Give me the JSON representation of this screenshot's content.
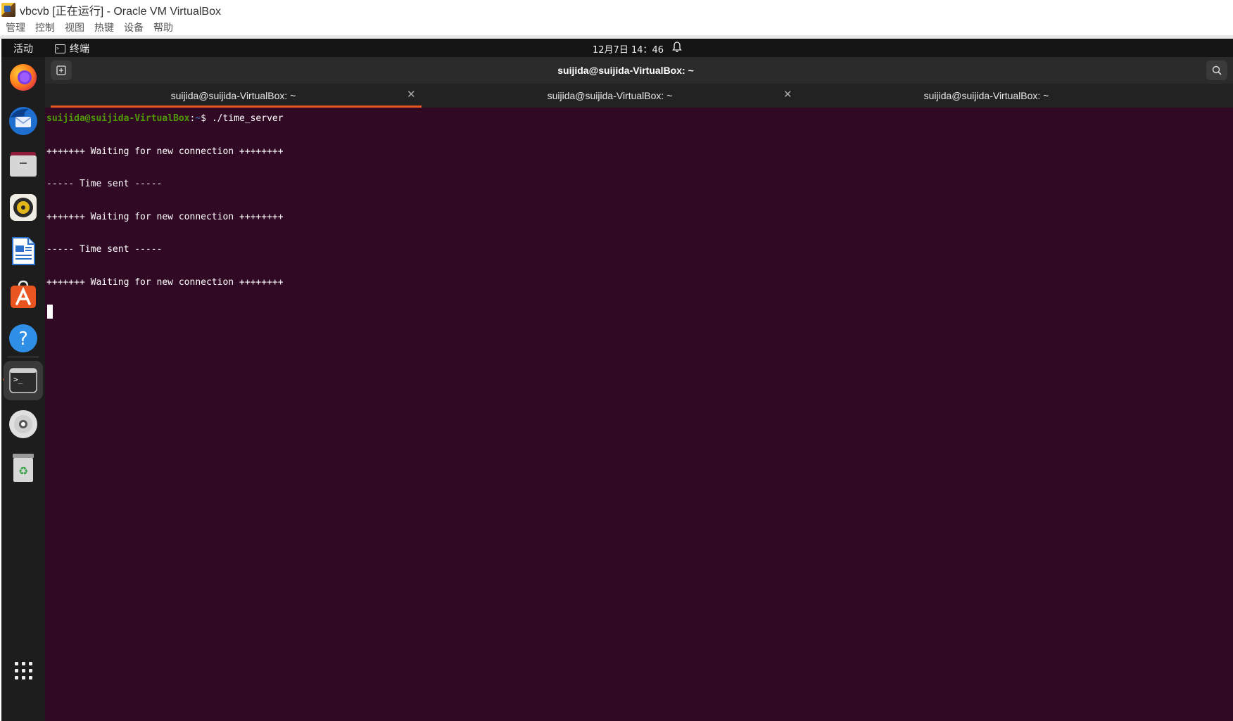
{
  "host": {
    "title": "vbcvb [正在运行] - Oracle VM VirtualBox",
    "menu": [
      "管理",
      "控制",
      "视图",
      "热键",
      "设备",
      "帮助"
    ]
  },
  "guest": {
    "topbar": {
      "activities": "活动",
      "app_name": "终端",
      "clock": "12月7日  14：46"
    },
    "dock": {
      "items": [
        "firefox-icon",
        "thunderbird-icon",
        "files-icon",
        "rhythmbox-icon",
        "libreoffice-writer-icon",
        "app-center-icon",
        "help-icon",
        "terminal-icon",
        "dvd-icon",
        "trash-icon",
        "show-apps-icon"
      ],
      "active": "terminal-icon"
    },
    "terminal": {
      "title": "suijida@suijida-VirtualBox: ~",
      "tabs": [
        {
          "label": "suijida@suijida-VirtualBox: ~",
          "active": true
        },
        {
          "label": "suijida@suijida-VirtualBox: ~",
          "active": false
        },
        {
          "label": "suijida@suijida-VirtualBox: ~",
          "active": false
        }
      ],
      "prompt_user": "suijida@suijida-VirtualBox",
      "prompt_sep": ":",
      "prompt_path": "~",
      "prompt_symbol": "$ ",
      "command": "./time_server",
      "output": [
        "+++++++ Waiting for new connection ++++++++",
        "----- Time sent -----",
        "+++++++ Waiting for new connection ++++++++",
        "----- Time sent -----",
        "+++++++ Waiting for new connection ++++++++"
      ]
    },
    "colors": {
      "terminal_bg": "#300a24",
      "accent": "#e95420",
      "prompt_user": "#4e9a06",
      "prompt_path": "#3465a4"
    }
  }
}
